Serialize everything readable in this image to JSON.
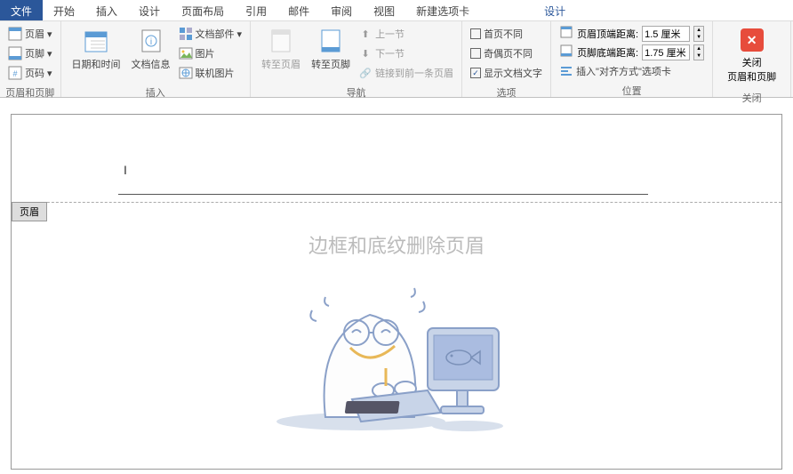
{
  "tabs": {
    "file": "文件",
    "home": "开始",
    "insert": "插入",
    "design": "设计",
    "layout": "页面布局",
    "references": "引用",
    "mail": "邮件",
    "review": "审阅",
    "view": "视图",
    "newtab": "新建选项卡",
    "ctx_design": "设计"
  },
  "ribbon": {
    "hf_group": {
      "header": "页眉",
      "footer": "页脚",
      "pagenum": "页码",
      "label": "页眉和页脚"
    },
    "insert_group": {
      "datetime": "日期和时间",
      "docinfo": "文档信息",
      "parts": "文档部件",
      "picture": "图片",
      "online_pic": "联机图片",
      "label": "插入"
    },
    "nav_group": {
      "goto_header": "转至页眉",
      "goto_footer": "转至页脚",
      "prev": "上一节",
      "next": "下一节",
      "link_prev": "链接到前一条页眉",
      "label": "导航"
    },
    "options_group": {
      "first_diff": "首页不同",
      "odd_even": "奇偶页不同",
      "show_text": "显示文档文字",
      "label": "选项"
    },
    "position_group": {
      "header_dist": "页眉顶端距离:",
      "header_val": "1.5 厘米",
      "footer_dist": "页脚底端距离:",
      "footer_val": "1.75 厘米",
      "align_tab": "插入\"对齐方式\"选项卡",
      "label": "位置"
    },
    "close_group": {
      "close": "关闭",
      "close2": "页眉和页脚",
      "label": "关闭"
    }
  },
  "doc": {
    "badge": "页眉",
    "watermark": "边框和底纹删除页眉"
  }
}
